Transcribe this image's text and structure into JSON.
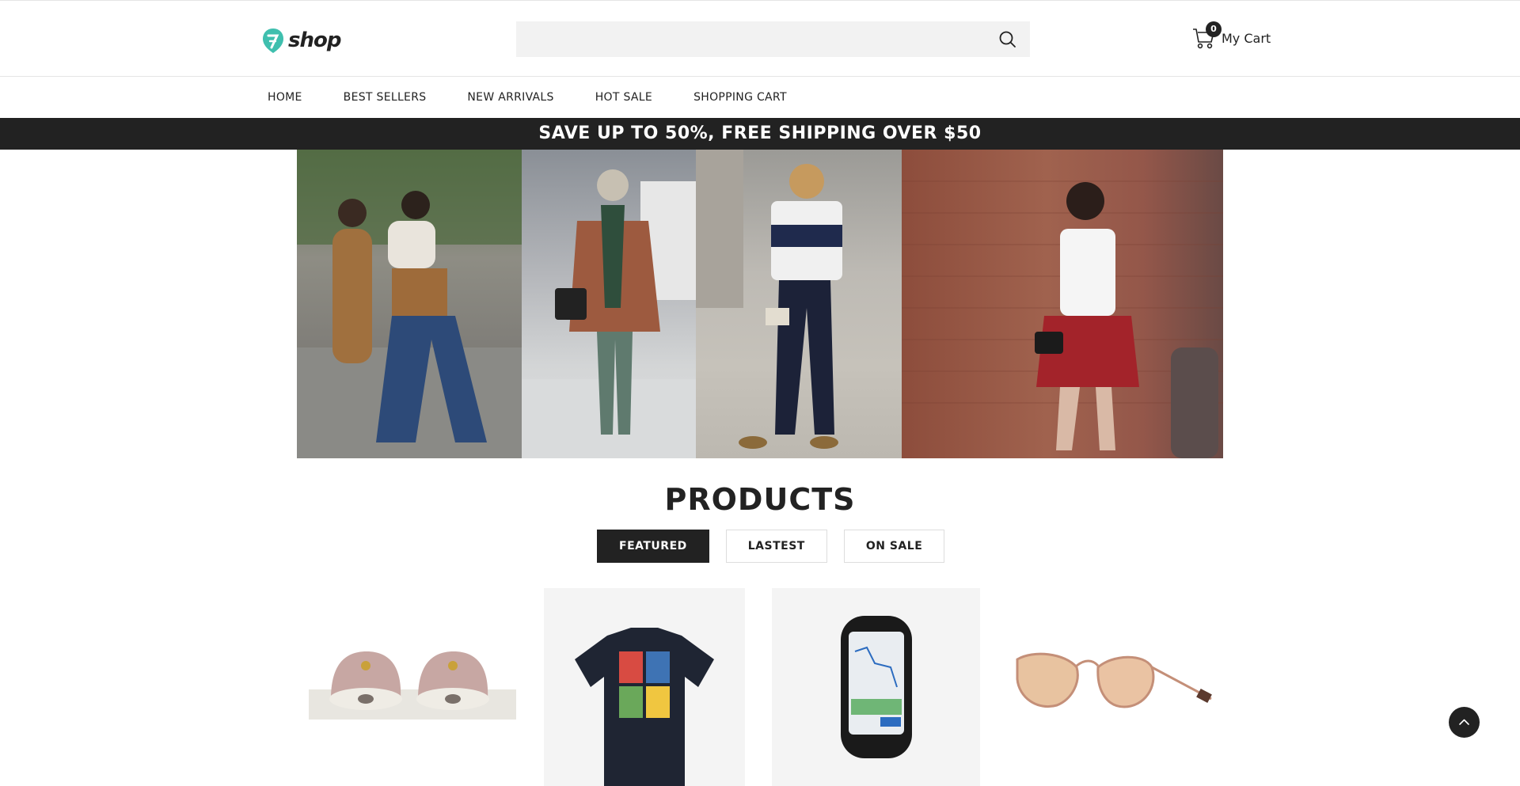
{
  "header": {
    "logo_text": "shop",
    "search": {
      "placeholder": "",
      "value": ""
    },
    "cart": {
      "count": "0",
      "label": "My Cart"
    }
  },
  "nav": {
    "items": [
      {
        "label": "HOME"
      },
      {
        "label": "BEST SELLERS"
      },
      {
        "label": "NEW ARRIVALS"
      },
      {
        "label": "HOT SALE"
      },
      {
        "label": "SHOPPING CART"
      }
    ]
  },
  "promo": {
    "text": "SAVE UP TO 50%, FREE SHIPPING OVER $50"
  },
  "hero": {
    "panels": [
      "street-style-photo-1",
      "street-style-photo-2",
      "street-style-photo-3",
      "street-style-photo-4"
    ]
  },
  "products": {
    "title": "PRODUCTS",
    "tabs": [
      {
        "label": "FEATURED",
        "active": true
      },
      {
        "label": "LASTEST",
        "active": false
      },
      {
        "label": "ON SALE",
        "active": false
      }
    ],
    "items": [
      {
        "image": "pink-sneakers"
      },
      {
        "image": "black-tshirt-princesses"
      },
      {
        "image": "gps-bike-computer"
      },
      {
        "image": "rose-gold-sunglasses"
      }
    ]
  },
  "colors": {
    "brand_teal": "#3fbfae",
    "dark": "#222222"
  }
}
